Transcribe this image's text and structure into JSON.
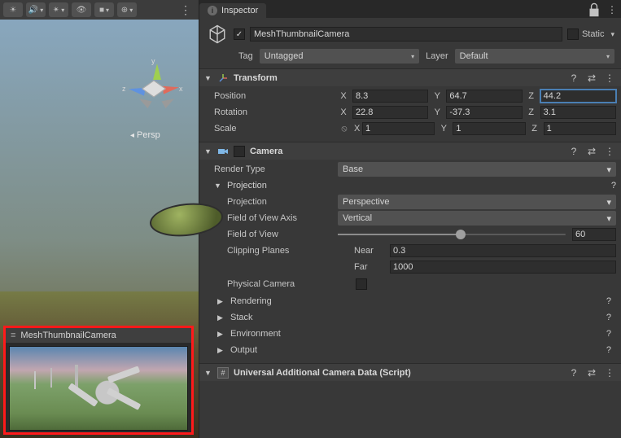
{
  "scene": {
    "persp_label": "Persp",
    "preview_title": "MeshThumbnailCamera"
  },
  "inspector": {
    "tab": "Inspector",
    "name": "MeshThumbnailCamera",
    "enabled": true,
    "static_label": "Static",
    "tag_label": "Tag",
    "tag_value": "Untagged",
    "layer_label": "Layer",
    "layer_value": "Default"
  },
  "transform": {
    "title": "Transform",
    "position_label": "Position",
    "rotation_label": "Rotation",
    "scale_label": "Scale",
    "position": {
      "x": "8.3",
      "y": "64.7",
      "z": "44.2"
    },
    "rotation": {
      "x": "22.8",
      "y": "-37.3",
      "z": "3.1"
    },
    "scale": {
      "x": "1",
      "y": "1",
      "z": "1"
    }
  },
  "camera": {
    "title": "Camera",
    "render_type_label": "Render Type",
    "render_type_value": "Base",
    "projection_header": "Projection",
    "projection_label": "Projection",
    "projection_value": "Perspective",
    "fov_axis_label": "Field of View Axis",
    "fov_axis_value": "Vertical",
    "fov_label": "Field of View",
    "fov_value": "60",
    "clip_label": "Clipping Planes",
    "near_label": "Near",
    "near_value": "0.3",
    "far_label": "Far",
    "far_value": "1000",
    "physical_label": "Physical Camera",
    "foldouts": {
      "rendering": "Rendering",
      "stack": "Stack",
      "environment": "Environment",
      "output": "Output"
    }
  },
  "urp": {
    "title": "Universal Additional Camera Data (Script)"
  }
}
